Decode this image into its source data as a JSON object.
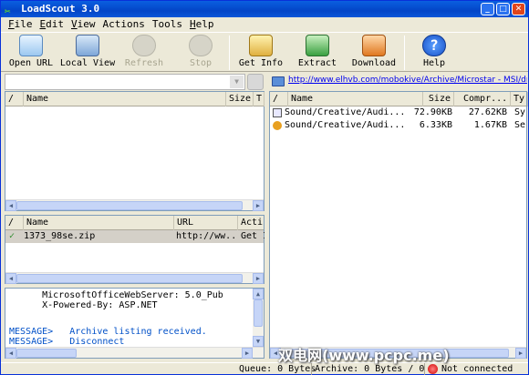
{
  "window": {
    "title": "LoadScout 3.0",
    "min": "_",
    "max": "□",
    "close": "✕"
  },
  "menu": [
    {
      "k": "F",
      "r": "ile"
    },
    {
      "k": "E",
      "r": "dit"
    },
    {
      "k": "V",
      "r": "iew"
    },
    {
      "k": "",
      "r": "Actions"
    },
    {
      "k": "",
      "r": "Tools"
    },
    {
      "k": "H",
      "r": "elp"
    }
  ],
  "toolbar": {
    "open_url": "Open URL",
    "local_view": "Local View",
    "refresh": "Refresh",
    "stop": "Stop",
    "get_info": "Get Info",
    "extract": "Extract",
    "download": "Download",
    "help": "Help"
  },
  "left_top": {
    "headers": [
      "/",
      "Name",
      "Size",
      "T"
    ]
  },
  "archive_url": "http://www.elhvb.com/mobokive/Archive/Microstar - MSI/driver/drive",
  "right": {
    "headers": [
      "/",
      "Name",
      "Size",
      "Compr...",
      "Ty"
    ],
    "rows": [
      {
        "name": "Sound/Creative/Audi...",
        "size": "72.90KB",
        "compr": "27.62KB",
        "type": "Sy"
      },
      {
        "name": "Sound/Creative/Audi...",
        "size": "6.33KB",
        "compr": "1.67KB",
        "type": "Se"
      }
    ]
  },
  "queue": {
    "headers": [
      "/",
      "Name",
      "URL",
      "Acti"
    ],
    "rows": [
      {
        "name": "1373_98se.zip",
        "url": "http://ww...",
        "action": "Get I"
      }
    ]
  },
  "log": {
    "lines": [
      {
        "p": "",
        "t": "      MicrosoftOfficeWebServer: 5.0_Pub"
      },
      {
        "p": "",
        "t": "      X-Powered-By: ASP.NET"
      },
      {
        "p": "",
        "t": ""
      },
      {
        "p": "MESSAGE>",
        "t": "   Archive listing received."
      },
      {
        "p": "MESSAGE>",
        "t": "   Disconnect"
      }
    ]
  },
  "status": {
    "queue": "Queue: 0 Bytes",
    "archive": "Archive: 0 Bytes / 0",
    "conn": "Not connected"
  },
  "watermark": "双电网(www.pcpc.me)"
}
